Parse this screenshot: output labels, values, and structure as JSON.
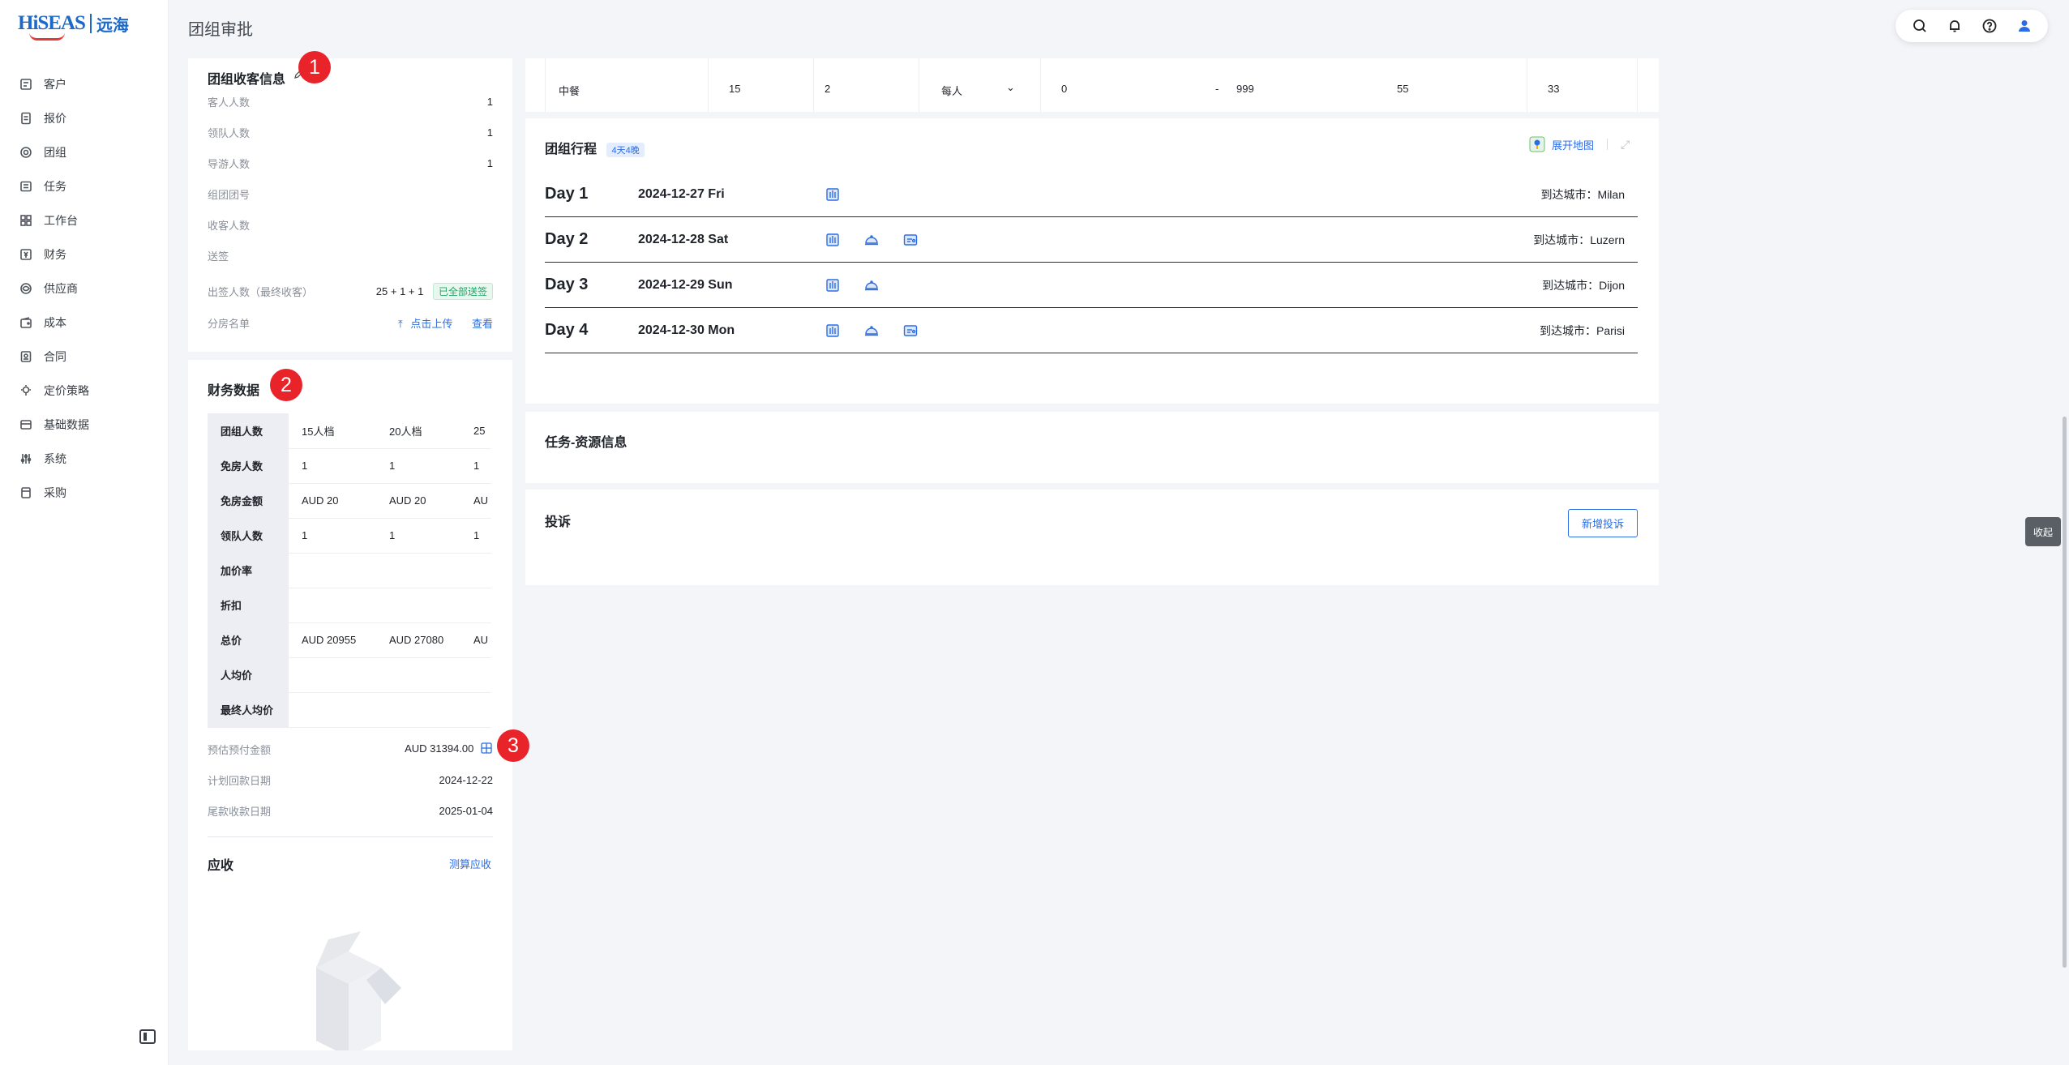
{
  "app": {
    "logo_text": "HiSEAS",
    "logo_cn": "远海",
    "page_title": "团组审批"
  },
  "sidebar": {
    "items": [
      {
        "label": "客户",
        "icon": "customer-icon"
      },
      {
        "label": "报价",
        "icon": "quote-icon"
      },
      {
        "label": "团组",
        "icon": "group-icon"
      },
      {
        "label": "任务",
        "icon": "task-icon"
      },
      {
        "label": "工作台",
        "icon": "workbench-icon"
      },
      {
        "label": "财务",
        "icon": "finance-icon"
      },
      {
        "label": "供应商",
        "icon": "supplier-icon"
      },
      {
        "label": "成本",
        "icon": "cost-icon"
      },
      {
        "label": "合同",
        "icon": "contract-icon"
      },
      {
        "label": "定价策略",
        "icon": "pricing-icon"
      },
      {
        "label": "基础数据",
        "icon": "base-data-icon"
      },
      {
        "label": "系统",
        "icon": "system-icon"
      },
      {
        "label": "采购",
        "icon": "purchase-icon"
      }
    ]
  },
  "header": {
    "tools": [
      "search-icon",
      "bell-icon",
      "help-icon",
      "user-icon"
    ]
  },
  "guest_info": {
    "title": "团组收客信息",
    "rows": [
      {
        "label": "客人人数",
        "value": "1"
      },
      {
        "label": "领队人数",
        "value": "1"
      },
      {
        "label": "导游人数",
        "value": "1"
      },
      {
        "label": "组团团号",
        "value": ""
      },
      {
        "label": "收客人数",
        "value": ""
      },
      {
        "label": "送签",
        "value": ""
      }
    ],
    "visa_label": "出签人数（最终收客）",
    "visa_value": "25 + 1 + 1",
    "visa_badge": "已全部送签",
    "room_label": "分房名单",
    "upload_link": "点击上传",
    "view_link": "查看"
  },
  "finance": {
    "title": "财务数据",
    "rows": [
      {
        "label": "团组人数",
        "cells": [
          "15人档",
          "20人档",
          "25"
        ]
      },
      {
        "label": "免房人数",
        "cells": [
          "1",
          "1",
          "1"
        ]
      },
      {
        "label": "免房金额",
        "cells": [
          "AUD 20",
          "AUD 20",
          "AU"
        ]
      },
      {
        "label": "领队人数",
        "cells": [
          "1",
          "1",
          "1"
        ]
      },
      {
        "label": "加价率",
        "cells": [
          "",
          "",
          ""
        ]
      },
      {
        "label": "折扣",
        "cells": [
          "",
          "",
          ""
        ]
      },
      {
        "label": "总价",
        "cells": [
          "AUD 20955",
          "AUD 27080",
          "AU"
        ]
      },
      {
        "label": "人均价",
        "cells": [
          "",
          "",
          ""
        ]
      },
      {
        "label": "最终人均价",
        "cells": [
          "",
          "",
          ""
        ]
      }
    ],
    "prepay_label": "预估预付金额",
    "prepay_value": "AUD 31394.00",
    "plan_date_label": "计划回款日期",
    "plan_date_value": "2024-12-22",
    "final_date_label": "尾款收款日期",
    "final_date_value": "2025-01-04",
    "receivable_title": "应收",
    "calc_link": "测算应收"
  },
  "meal_row": {
    "name": "中餐",
    "c1": "15",
    "c2": "2",
    "unit": "每人",
    "min": "0",
    "dash": "-",
    "max": "999",
    "c5": "55",
    "c6": "33"
  },
  "itinerary": {
    "title": "团组行程",
    "badge": "4天4晚",
    "map_link": "展开地图",
    "days": [
      {
        "day": "Day 1",
        "date": "2024-12-27 Fri",
        "icons": [
          "hotel-icon"
        ],
        "city_label": "到达城市：",
        "city": "Milan"
      },
      {
        "day": "Day 2",
        "date": "2024-12-28 Sat",
        "icons": [
          "hotel-icon",
          "meal-icon",
          "ticket-icon"
        ],
        "city_label": "到达城市：",
        "city": "Luzern"
      },
      {
        "day": "Day 3",
        "date": "2024-12-29 Sun",
        "icons": [
          "hotel-icon",
          "meal-icon"
        ],
        "city_label": "到达城市：",
        "city": "Dijon"
      },
      {
        "day": "Day 4",
        "date": "2024-12-30 Mon",
        "icons": [
          "hotel-icon",
          "meal-icon",
          "ticket-icon"
        ],
        "city_label": "到达城市：",
        "city": "Parisi"
      }
    ]
  },
  "tasks": {
    "title": "任务-资源信息"
  },
  "complaints": {
    "title": "投诉",
    "add_button": "新增投诉"
  },
  "markers": [
    "1",
    "2",
    "3"
  ],
  "collapse_label": "收起"
}
